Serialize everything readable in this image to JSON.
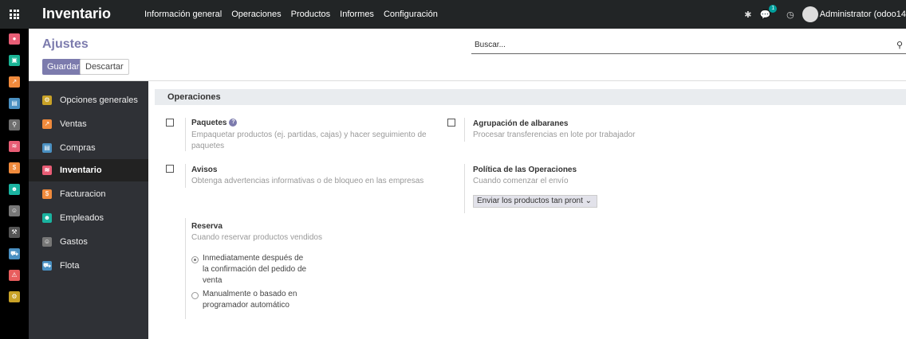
{
  "topbar": {
    "brand": "Inventario",
    "menu": [
      "Información general",
      "Operaciones",
      "Productos",
      "Informes",
      "Configuración"
    ],
    "user": "Administrator (odoo14",
    "message_count": "1"
  },
  "apps": [
    {
      "icon": "discuss-icon",
      "color": "#e85d75"
    },
    {
      "icon": "calendar-icon",
      "color": "#1ab394"
    },
    {
      "icon": "sales-icon",
      "color": "#f08a3c"
    },
    {
      "icon": "purchase-icon",
      "color": "#4a90c2"
    },
    {
      "icon": "link-icon",
      "color": "#6e6e6e"
    },
    {
      "icon": "inventory-icon",
      "color": "#e85d75"
    },
    {
      "icon": "invoicing-icon",
      "color": "#f08a3c"
    },
    {
      "icon": "employees-icon",
      "color": "#1ab3a0"
    },
    {
      "icon": "expenses-icon",
      "color": "#777"
    },
    {
      "icon": "tools-icon",
      "color": "#555"
    },
    {
      "icon": "fleet-icon",
      "color": "#4a90c2"
    },
    {
      "icon": "activity-icon",
      "color": "#e85d5d"
    },
    {
      "icon": "settings-icon",
      "color": "#c9a227"
    }
  ],
  "control_panel": {
    "title": "Ajustes",
    "save_label": "Guardar",
    "discard_label": "Descartar",
    "search_placeholder": "Buscar..."
  },
  "sidebar": {
    "items": [
      {
        "label": "Opciones generales",
        "icon": "gear-icon",
        "color": "#c9a227"
      },
      {
        "label": "Ventas",
        "icon": "chart-icon",
        "color": "#f08a3c"
      },
      {
        "label": "Compras",
        "icon": "card-icon",
        "color": "#4a90c2"
      },
      {
        "label": "Inventario",
        "icon": "box-icon",
        "color": "#e85d75"
      },
      {
        "label": "Facturacion",
        "icon": "invoice-icon",
        "color": "#f08a3c"
      },
      {
        "label": "Empleados",
        "icon": "people-icon",
        "color": "#1ab3a0"
      },
      {
        "label": "Gastos",
        "icon": "expense-icon",
        "color": "#777"
      },
      {
        "label": "Flota",
        "icon": "car-icon",
        "color": "#4a90c2"
      }
    ]
  },
  "main": {
    "section_title": "Operaciones",
    "paquetes": {
      "title": "Paquetes",
      "desc1": "Empaquetar productos (ej. partidas, cajas) y hacer seguimiento de",
      "desc2": "paquetes"
    },
    "agrupacion": {
      "title": "Agrupación de albaranes",
      "desc": "Procesar transferencias en lote por trabajador"
    },
    "avisos": {
      "title": "Avisos",
      "desc": "Obtenga advertencias informativas o de bloqueo en las empresas"
    },
    "politica": {
      "title": "Política de las Operaciones",
      "desc": "Cuando comenzar el envío",
      "select": "Enviar los productos tan pront ⌄"
    },
    "reserva": {
      "title": "Reserva",
      "desc": "Cuando reservar productos vendidos",
      "option1": [
        "Inmediatamente después de",
        "la confirmación del pedido de",
        "venta"
      ],
      "option2": [
        "Manualmente o basado en",
        "programador automático"
      ]
    }
  }
}
